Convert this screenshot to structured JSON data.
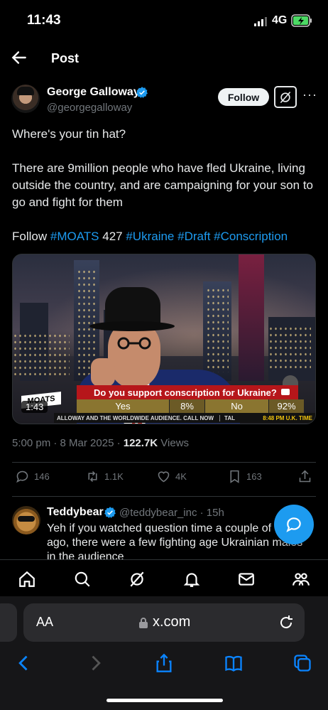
{
  "status_bar": {
    "time": "11:43",
    "network": "4G"
  },
  "header": {
    "title": "Post"
  },
  "post": {
    "author_name": "George Galloway",
    "author_handle": "@georgegalloway",
    "follow_label": "Follow",
    "text_line1": "Where's your tin hat?",
    "text_line2": "There are 9million people who have fled Ukraine, living outside the country, and are campaigning for your son to go and fight for them",
    "text_follow": "Follow",
    "tag_moats": "#MOATS",
    "channel_number": "427",
    "tag_ukraine": "#Ukraine",
    "tag_draft": "#Draft",
    "tag_conscription": "#Conscription",
    "timestamp": "5:00 pm · 8 Mar 2025 · ",
    "views_count": "122.7K",
    "views_label": " Views",
    "colors": {
      "accent": "#1d9bf0",
      "muted": "#71767b"
    }
  },
  "video": {
    "poll_question": "Do you support conscription for Ukraine?",
    "yes_label": "Yes",
    "yes_pct": "8%",
    "no_label": "No",
    "no_pct": "92%",
    "ticker_left": "ALLOWAY AND THE WORLDWIDE AUDIENCE. CALL NOW",
    "ticker_mid": "TAL",
    "ticker_right": "8:48 PM U.K. TIME",
    "logo": "MOATS",
    "duration": "1:43"
  },
  "actions": {
    "replies": "146",
    "reposts": "1.1K",
    "likes": "4K",
    "bookmarks": "163"
  },
  "reply": {
    "author_name": "Teddybear",
    "author_handle": "@teddybear_inc · 15h",
    "text": "Yeh if you watched question time a couple of weeks ago, there were a few fighting age Ukrainian males in the audience"
  },
  "tabbar": {
    "items": [
      "home-icon",
      "search-icon",
      "grok-icon",
      "notifications-icon",
      "messages-icon",
      "communities-icon"
    ]
  },
  "safari": {
    "text_size_label": "AA",
    "url": "x.com"
  }
}
